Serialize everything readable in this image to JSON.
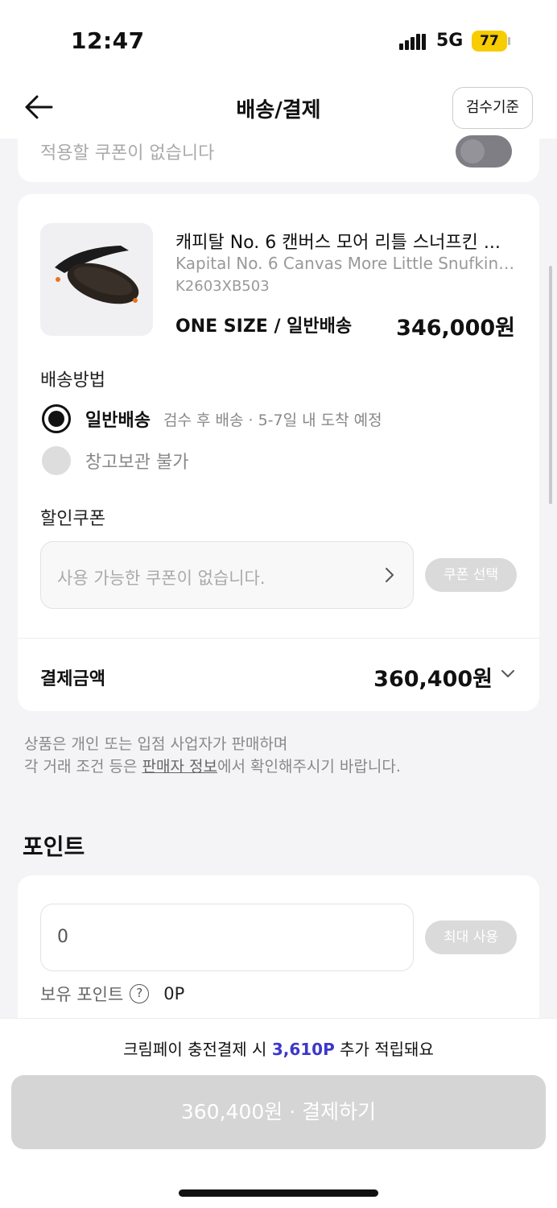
{
  "status": {
    "time": "12:47",
    "network": "5G",
    "battery": "77"
  },
  "nav": {
    "title": "배송/결제",
    "inspect_label": "검수기준"
  },
  "coupon_top": {
    "text": "적용할 쿠폰이 없습니다"
  },
  "product": {
    "name": "캐피탈 No. 6 캔버스 모어 리틀 스너프킨 ...",
    "name_en": "Kapital No. 6 Canvas More Little Snufkin ...",
    "code": "K2603XB503",
    "option": "ONE SIZE / 일반배송",
    "price": "346,000원"
  },
  "shipping": {
    "label": "배송방법",
    "options": [
      {
        "label": "일반배송",
        "desc": "검수 후 배송 · 5-7일 내 도착 예정"
      },
      {
        "label": "창고보관 불가"
      }
    ]
  },
  "discount": {
    "label": "할인쿠폰",
    "placeholder": "사용 가능한 쿠폰이 없습니다.",
    "button": "쿠폰 선택"
  },
  "payment": {
    "label": "결제금액",
    "amount": "360,400원"
  },
  "notice": {
    "line1": "상품은 개인 또는 입점 사업자가 판매하며",
    "line2_pre": "각 거래 조건 등은 ",
    "line2_link": "판매자 정보",
    "line2_post": "에서 확인해주시기 바랍니다."
  },
  "points": {
    "title": "포인트",
    "input_value": "0",
    "max_button": "최대 사용",
    "owned_label": "보유 포인트",
    "owned_value": "0P"
  },
  "bottom": {
    "reward_pre": "크림페이 충전결제 시 ",
    "reward_highlight": "3,610P",
    "reward_post": " 추가 적립돼요",
    "pay_button": "360,400원 · 결제하기",
    "highlight_color": "#3d38c9"
  }
}
